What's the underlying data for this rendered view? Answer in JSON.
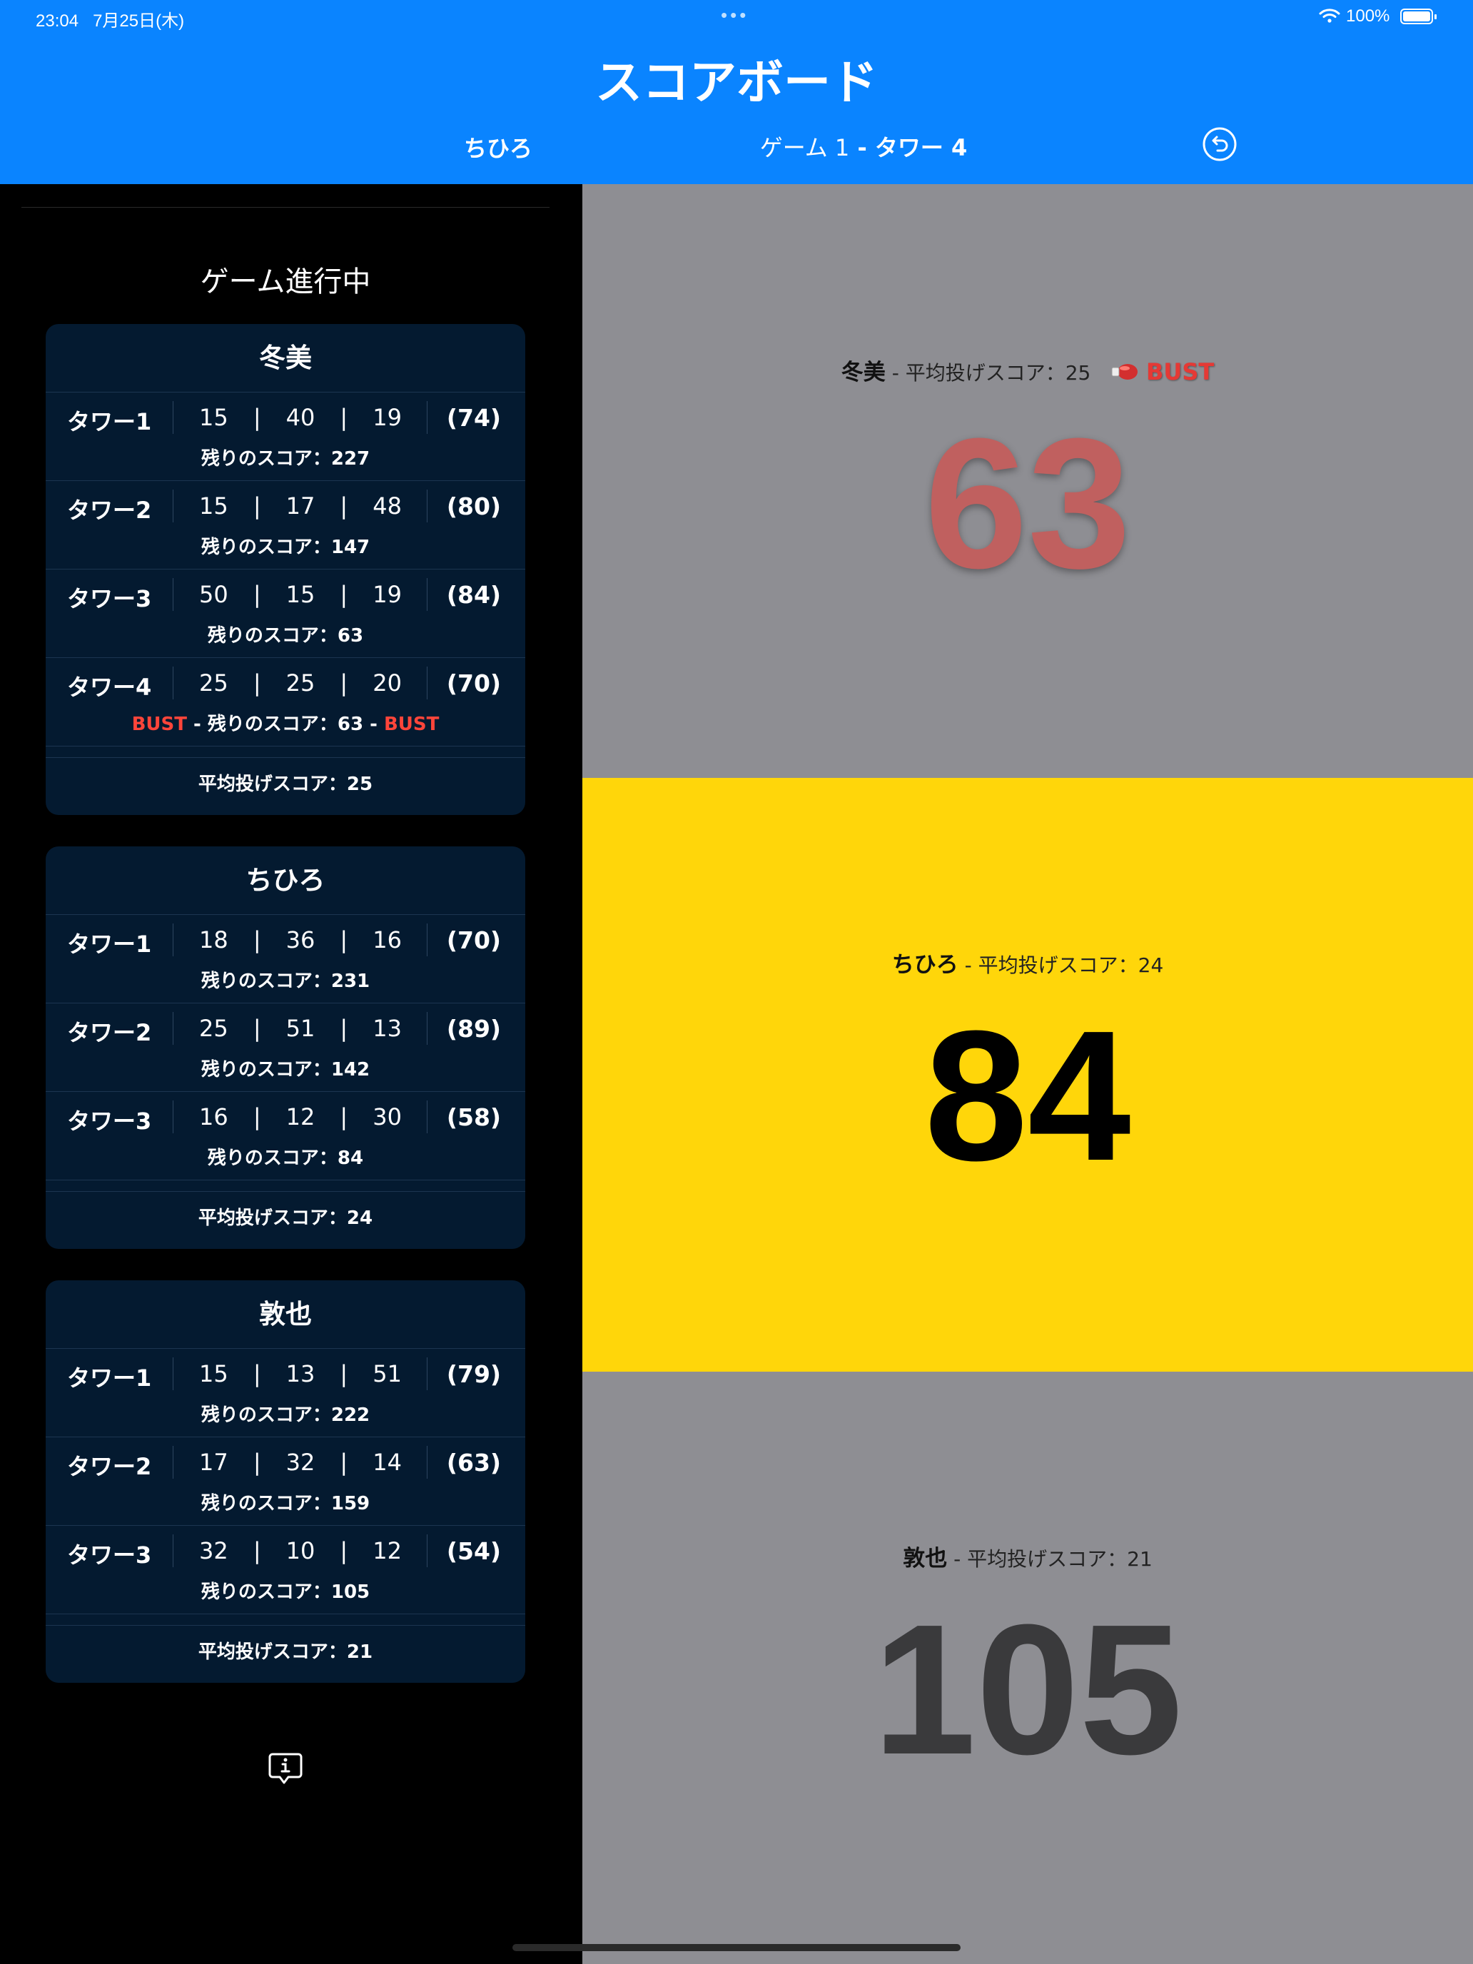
{
  "status_bar": {
    "time": "23:04",
    "date": "7月25日(木)",
    "dots": "•••",
    "battery": "100%"
  },
  "header": {
    "title": "スコアボード",
    "current_player": "ちひろ",
    "game_label": "ゲーム 1",
    "tower_label": " - タワー 4",
    "undo_icon": "undo-arrow-icon"
  },
  "sidebar": {
    "heading": "ゲーム進行中",
    "info_icon": "info-bubble-icon",
    "players": [
      {
        "name": "冬美",
        "avg": "平均投げスコア：25",
        "rows": [
          {
            "tower": "タワー1",
            "t1": "15",
            "t2": "40",
            "t3": "19",
            "total": "(74)",
            "rem": "残りのスコア：227",
            "bust_l": "",
            "bust_r": ""
          },
          {
            "tower": "タワー2",
            "t1": "15",
            "t2": "17",
            "t3": "48",
            "total": "(80)",
            "rem": "残りのスコア：147",
            "bust_l": "",
            "bust_r": ""
          },
          {
            "tower": "タワー3",
            "t1": "50",
            "t2": "15",
            "t3": "19",
            "total": "(84)",
            "rem": "残りのスコア：63",
            "bust_l": "",
            "bust_r": ""
          },
          {
            "tower": "タワー4",
            "t1": "25",
            "t2": "25",
            "t3": "20",
            "total": "(70)",
            "rem": " - 残りのスコア：63 - ",
            "bust_l": "BUST",
            "bust_r": "BUST"
          }
        ]
      },
      {
        "name": "ちひろ",
        "avg": "平均投げスコア：24",
        "rows": [
          {
            "tower": "タワー1",
            "t1": "18",
            "t2": "36",
            "t3": "16",
            "total": "(70)",
            "rem": "残りのスコア：231",
            "bust_l": "",
            "bust_r": ""
          },
          {
            "tower": "タワー2",
            "t1": "25",
            "t2": "51",
            "t3": "13",
            "total": "(89)",
            "rem": "残りのスコア：142",
            "bust_l": "",
            "bust_r": ""
          },
          {
            "tower": "タワー3",
            "t1": "16",
            "t2": "12",
            "t3": "30",
            "total": "(58)",
            "rem": "残りのスコア：84",
            "bust_l": "",
            "bust_r": ""
          }
        ]
      },
      {
        "name": "敦也",
        "avg": "平均投げスコア：21",
        "rows": [
          {
            "tower": "タワー1",
            "t1": "15",
            "t2": "13",
            "t3": "51",
            "total": "(79)",
            "rem": "残りのスコア：222",
            "bust_l": "",
            "bust_r": ""
          },
          {
            "tower": "タワー2",
            "t1": "17",
            "t2": "32",
            "t3": "14",
            "total": "(63)",
            "rem": "残りのスコア：159",
            "bust_l": "",
            "bust_r": ""
          },
          {
            "tower": "タワー3",
            "t1": "32",
            "t2": "10",
            "t3": "12",
            "total": "(54)",
            "rem": "残りのスコア：105",
            "bust_l": "",
            "bust_r": ""
          }
        ]
      }
    ]
  },
  "panels": [
    {
      "name": "冬美",
      "avg": " - 平均投げスコア：25",
      "bust": "BUST",
      "bust_icon": "boxing-glove-icon",
      "score": "63",
      "bg": "#8e8e93",
      "color": "#c0605f"
    },
    {
      "name": "ちひろ",
      "avg": " - 平均投げスコア：24",
      "bust": "",
      "score": "84",
      "bg": "#ffd60a",
      "color": "#000000"
    },
    {
      "name": "敦也",
      "avg": " - 平均投げスコア：21",
      "bust": "",
      "score": "105",
      "bg": "#8e8e93",
      "color": "#3a3a3c"
    }
  ],
  "colors": {
    "accent": "#0a84ff",
    "card_bg": "#041a30",
    "bust": "#ff453a",
    "active_panel": "#ffd60a",
    "inactive_panel": "#8e8e93"
  }
}
